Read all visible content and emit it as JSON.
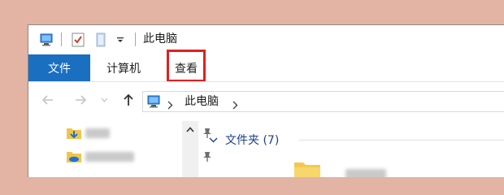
{
  "window": {
    "title": "此电脑"
  },
  "quick_access": {
    "icons": [
      "computer-icon",
      "properties-icon",
      "new-folder-icon",
      "customize-dropdown-icon"
    ]
  },
  "ribbon": {
    "tab_file": "文件",
    "tab_computer": "计算机",
    "tab_view": "查看",
    "highlighted_tab": "查看",
    "highlight_color": "#e02020",
    "file_tab_color": "#1a6fc1"
  },
  "navigation": {
    "icons": [
      "back-arrow-icon",
      "forward-arrow-icon",
      "recent-dropdown-icon",
      "up-arrow-icon"
    ]
  },
  "address_bar": {
    "location": "此电脑"
  },
  "content": {
    "group_label": "文件夹 (7)"
  }
}
